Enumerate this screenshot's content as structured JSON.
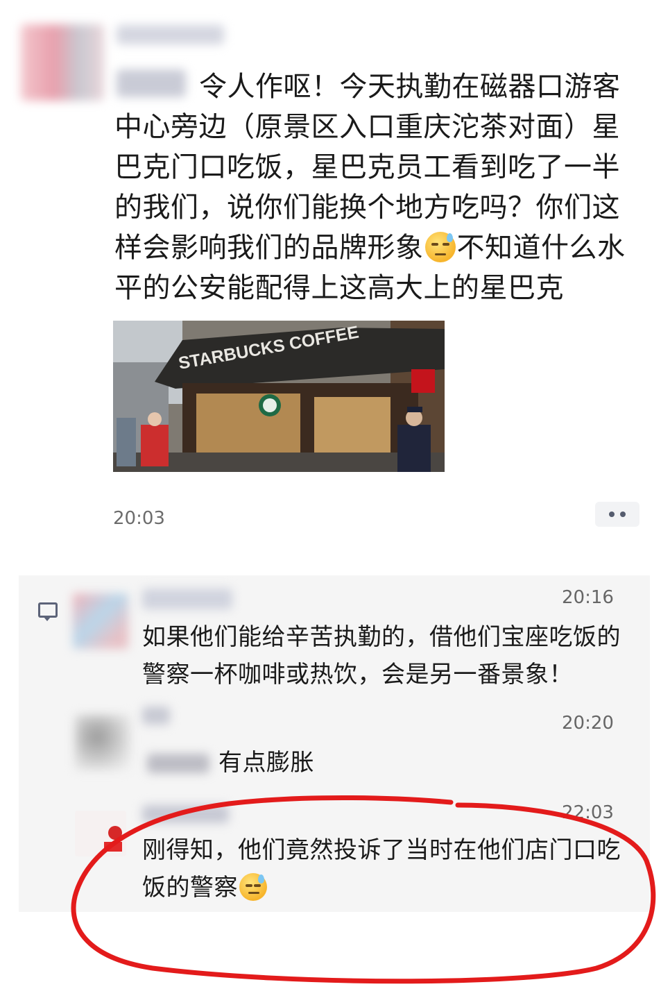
{
  "post": {
    "text_before_emoji": "令人作呕！今天执勤在磁器口游客中心旁边（原景区入口重庆沱茶对面）星巴克门口吃饭，星巴克员工看到吃了一半的我们，说你们能换个地方吃吗？你们这样会影响我们的品牌形象",
    "text_after_emoji": "不知道什么水平的公安能配得上这高大上的星巴克",
    "image_sign": "STARBUCKS COFFEE",
    "time": "20:03"
  },
  "comments": [
    {
      "time": "20:16",
      "text": "如果他们能给辛苦执勤的，借他们宝座吃饭的警察一杯咖啡或热饮，会是另一番景象！"
    },
    {
      "time": "20:20",
      "text": "有点膨胀"
    },
    {
      "time": "22:03",
      "text": "刚得知，他们竟然投诉了当时在他们店门口吃饭的警察"
    }
  ],
  "icons": {
    "more": "more-dots-icon",
    "comment": "comment-icon",
    "emoji_1": "sweat-squint-emoji-icon",
    "emoji_2": "unamused-sweat-emoji-icon"
  },
  "colors": {
    "highlight_circle": "#e31b1b",
    "comment_panel": "#f5f5f5"
  }
}
